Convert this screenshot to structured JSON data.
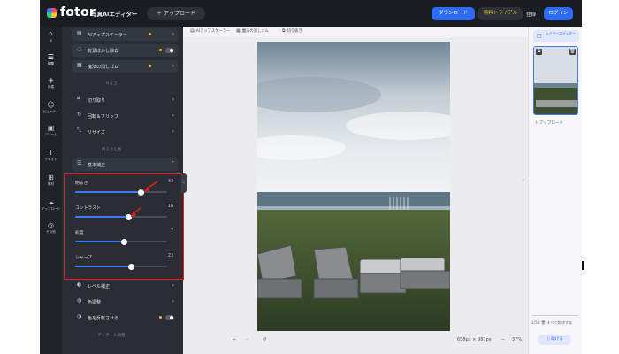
{
  "topbar": {
    "brand": "fotor",
    "editor_menu": "写真AIエディター",
    "upload": "＋ アップロード",
    "download": "ダウンロード",
    "trial": "無料トライアル",
    "register": "登録",
    "login": "ログイン"
  },
  "rail": [
    {
      "icon": "ai-sparkle-icon",
      "label": "AI"
    },
    {
      "icon": "adjust-sliders-icon",
      "label": "調整"
    },
    {
      "icon": "effects-icon",
      "label": "効果"
    },
    {
      "icon": "beauty-icon",
      "label": "ビューティ"
    },
    {
      "icon": "frame-icon",
      "label": "フレーム"
    },
    {
      "icon": "text-icon",
      "label": "テキスト"
    },
    {
      "icon": "elements-icon",
      "label": "素材"
    },
    {
      "icon": "cloud-upload-icon",
      "label": "アップロード"
    },
    {
      "icon": "more-icon",
      "label": "その他"
    }
  ],
  "panel": {
    "ai_tools": [
      {
        "label": "AIアップスケーラー",
        "control": "chevron"
      },
      {
        "label": "背景ぼかし除去",
        "control": "toggle"
      },
      {
        "label": "魔法の消しゴム",
        "control": "chevron"
      }
    ],
    "section_size": "サイズ",
    "size_tools": [
      {
        "label": "切り取り"
      },
      {
        "label": "回転＆フリップ"
      },
      {
        "label": "リサイズ"
      }
    ],
    "section_brightness": "明るさと色",
    "basic_adjust": "基本補正",
    "adjustments": [
      {
        "label": "明るさ",
        "value": 43
      },
      {
        "label": "コントラスト",
        "value": 16
      },
      {
        "label": "彩度",
        "value": 7
      },
      {
        "label": "シャープ",
        "value": 23
      }
    ],
    "more_tools": [
      {
        "label": "レベル補正",
        "control": "chevron"
      },
      {
        "label": "色調整",
        "control": "chevron"
      },
      {
        "label": "色を反転させる",
        "control": "toggle"
      }
    ],
    "section_fine": "ディテール調整"
  },
  "toolbar2": {
    "upscale": "AIアップスケーラー",
    "eraser": "魔法の消しゴム",
    "cutout": "切り抜き"
  },
  "bottombar": {
    "size": "658px × 987px",
    "zoom": "37%"
  },
  "right": {
    "layers": "レイヤーエディター",
    "upload": "アップロード",
    "count": "1/50",
    "delete_all": "すべて削除する",
    "help": "助ける"
  },
  "colors": {
    "accent": "#2f6cf6",
    "highlight_box": "#e02020",
    "panel_bg": "#2a2d33",
    "topbar_bg": "#1a1d22"
  }
}
